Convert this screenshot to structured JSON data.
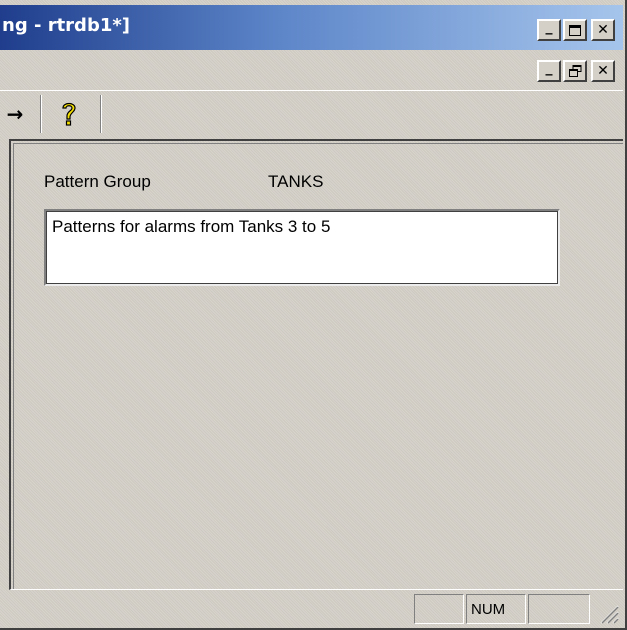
{
  "window": {
    "title": "ng - rtrdb1*]",
    "caption_buttons": {
      "minimize": "_",
      "maximize": "☐",
      "close": "✕"
    },
    "mdi_buttons": {
      "minimize": "_",
      "restore": "⧉",
      "close": "✕"
    }
  },
  "toolbar": {
    "arrow_glyph": "→",
    "help_glyph": "?",
    "help_color": "#f5e000"
  },
  "form": {
    "pattern_group_label": "Pattern Group",
    "pattern_group_value": "TANKS",
    "description": "Patterns for alarms from Tanks 3 to 5"
  },
  "statusbar": {
    "num_indicator": "NUM"
  },
  "colors": {
    "titlebar_start": "#1f3d8c",
    "titlebar_end": "#a6c5ec",
    "face": "#d4d0c8"
  }
}
